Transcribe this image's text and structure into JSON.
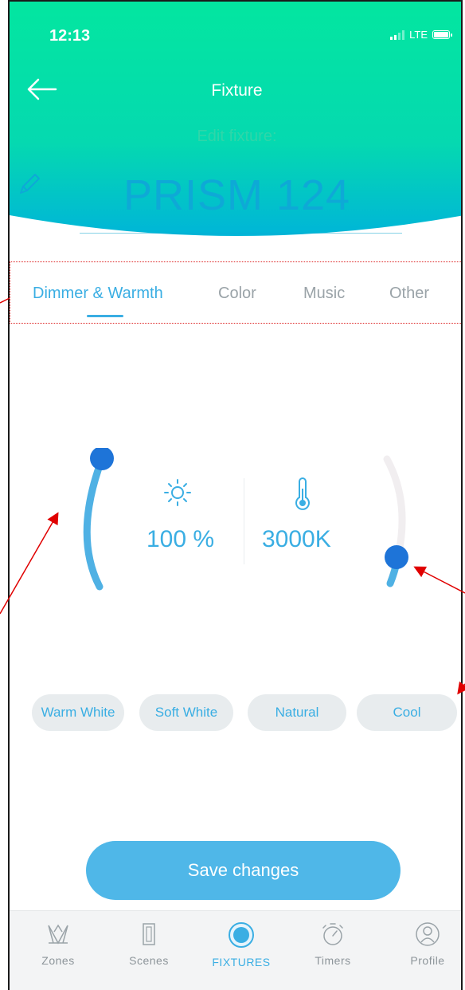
{
  "status": {
    "time": "12:13",
    "network": "LTE"
  },
  "header": {
    "title": "Fixture",
    "edit_label": "Edit fixture:",
    "fixture_name": "PRISM 124"
  },
  "tabs": [
    {
      "label": "Dimmer & Warmth",
      "active": true
    },
    {
      "label": "Color",
      "active": false
    },
    {
      "label": "Music",
      "active": false
    },
    {
      "label": "Other",
      "active": false
    }
  ],
  "controls": {
    "brightness": {
      "value": 100,
      "display": "100 %",
      "icon": "sun-icon"
    },
    "warmth": {
      "display": "3000K",
      "icon": "thermometer-icon",
      "level": 0.12
    }
  },
  "presets": [
    "Warm White",
    "Soft White",
    "Natural",
    "Cool"
  ],
  "save_label": "Save changes",
  "nav": [
    {
      "label": "Zones",
      "icon": "zones-icon",
      "active": false
    },
    {
      "label": "Scenes",
      "icon": "scenes-icon",
      "active": false
    },
    {
      "label": "FIXTURES",
      "icon": "fixtures-icon",
      "active": true
    },
    {
      "label": "Timers",
      "icon": "timer-icon",
      "active": false
    },
    {
      "label": "Profile",
      "icon": "profile-icon",
      "active": false
    }
  ],
  "colors": {
    "accent": "#3aaee3",
    "header_top": "#00e6a0",
    "header_bottom": "#00b6d6",
    "annotation": "#e00000"
  }
}
